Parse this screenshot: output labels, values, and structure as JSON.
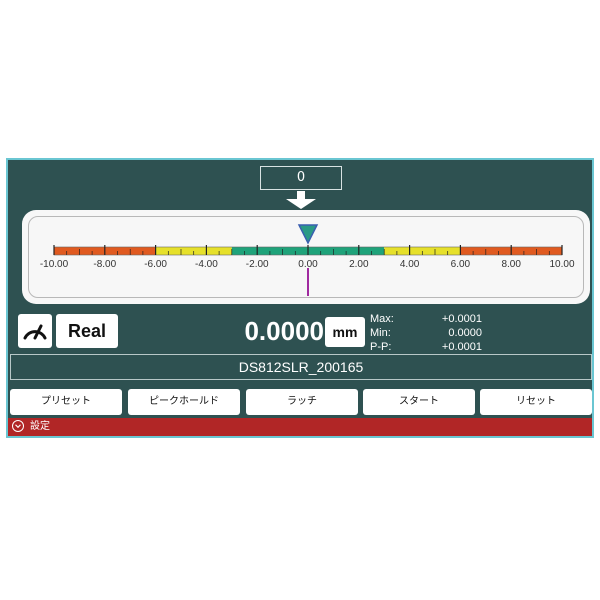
{
  "target": {
    "value": "0"
  },
  "gauge": {
    "tick_labels": [
      "-10.00",
      "-8.00",
      "-6.00",
      "-4.00",
      "-2.00",
      "0.00",
      "2.00",
      "4.00",
      "6.00",
      "8.00",
      "10.00"
    ],
    "min": -10,
    "max": 10,
    "pointer_value": 0,
    "zones": [
      {
        "from": -10,
        "to": -6,
        "color": "#e05a20"
      },
      {
        "from": -6,
        "to": -3,
        "color": "#e6e02a"
      },
      {
        "from": -3,
        "to": 3,
        "color": "#1fa37a"
      },
      {
        "from": 3,
        "to": 6,
        "color": "#e6e02a"
      },
      {
        "from": 6,
        "to": 10,
        "color": "#e05a20"
      }
    ]
  },
  "mode_icon": "speedometer-icon",
  "mode_label": "Real",
  "reading": {
    "value": "0.0000",
    "unit": "mm"
  },
  "stats": {
    "max_label": "Max:",
    "max_value": "+0.0001",
    "min_label": "Min:",
    "min_value": "0.0000",
    "pp_label": "P-P:",
    "pp_value": "+0.0001"
  },
  "device_name": "DS812SLR_200165",
  "buttons": {
    "preset": "プリセット",
    "peak_hold": "ピークホールド",
    "latch": "ラッチ",
    "start": "スタート",
    "reset": "リセット"
  },
  "settings": {
    "icon": "chevron-down-circle-icon",
    "label": "設定"
  },
  "colors": {
    "panel": "#2e5151",
    "border": "#6ac6d2",
    "settings_bar": "#b12626",
    "pointer_marker": "#a02aa0"
  }
}
